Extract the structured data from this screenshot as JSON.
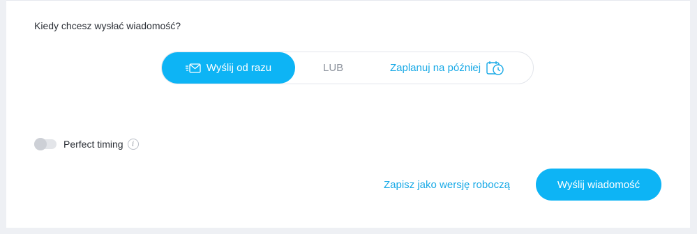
{
  "schedule": {
    "question": "Kiedy chcesz wysłać wiadomość?",
    "send_now_label": "Wyślij od razu",
    "send_now_icon": "envelope-icon",
    "or_label": "LUB",
    "schedule_later_label": "Zaplanuj na później",
    "schedule_later_icon": "calendar-clock-icon",
    "selected": "send_now"
  },
  "perfect_timing": {
    "label": "Perfect timing",
    "enabled": false,
    "info_icon_glyph": "i"
  },
  "actions": {
    "draft_label": "Zapisz jako wersję roboczą",
    "send_label": "Wyślij wiadomość"
  },
  "colors": {
    "accent": "#0db4f5",
    "link": "#18a9e6",
    "muted": "#8e949e",
    "text": "#2b2f36"
  }
}
